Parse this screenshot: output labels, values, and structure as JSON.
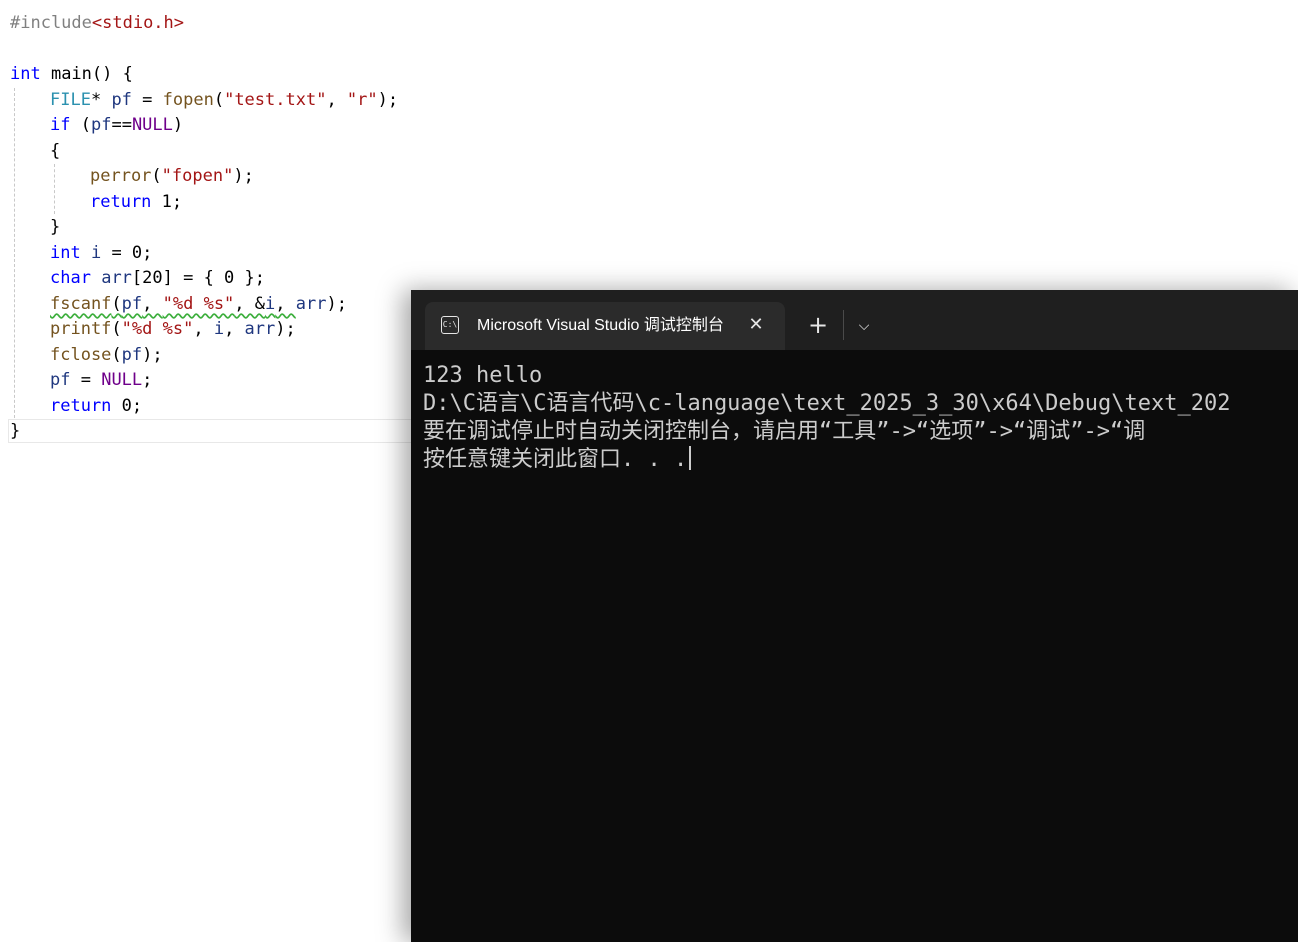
{
  "editor": {
    "l1": {
      "a": "#include",
      "b": "<stdio.h>"
    },
    "l3": {
      "a": "int",
      "b": " main() {"
    },
    "l4": {
      "a": "FILE",
      "b": "* ",
      "c": "pf",
      "d": " = ",
      "e": "fopen",
      "f": "(",
      "g": "\"test.txt\"",
      "h": ", ",
      "i": "\"r\"",
      "j": ");"
    },
    "l5": {
      "a": "if",
      "b": " (",
      "c": "pf",
      "d": "==",
      "e": "NULL",
      "f": ")"
    },
    "l6": {
      "a": "{"
    },
    "l7": {
      "a": "perror",
      "b": "(",
      "c": "\"fopen\"",
      "d": ");"
    },
    "l8": {
      "a": "return",
      "b": " 1;"
    },
    "l9": {
      "a": "}"
    },
    "l10": {
      "a": "int",
      "b": " ",
      "c": "i",
      "d": " = 0;"
    },
    "l11": {
      "a": "char",
      "b": " ",
      "c": "arr",
      "d": "[20] = { 0 };"
    },
    "l12": {
      "a": "fscanf",
      "b": "(",
      "c": "pf",
      "d": ", ",
      "e": "\"%d %s\"",
      "f": ", &",
      "g": "i",
      "h": ", ",
      "i": "arr",
      "j": ");"
    },
    "l13": {
      "a": "printf",
      "b": "(",
      "c": "\"%d %s\"",
      "d": ", ",
      "e": "i",
      "f": ", ",
      "g": "arr",
      "h": ");"
    },
    "l14": {
      "a": "fclose",
      "b": "(",
      "c": "pf",
      "d": ");"
    },
    "l15": {
      "a": "pf",
      "b": " = ",
      "c": "NULL",
      "d": ";"
    },
    "l16": {
      "a": "return",
      "b": " 0;"
    },
    "l17": {
      "a": "}"
    }
  },
  "terminal": {
    "tab_title": "Microsoft Visual Studio 调试控制台",
    "tab_icon": "terminal-icon",
    "close_glyph": "✕",
    "new_tab_glyph": "+",
    "dropdown_glyph": "⌵",
    "icon_text": "C:\\",
    "lines": [
      "123 hello",
      "D:\\C语言\\C语言代码\\c-language\\text_2025_3_30\\x64\\Debug\\text_202",
      "要在调试停止时自动关闭控制台，请启用“工具”->“选项”->“调试”->“调",
      "按任意键关闭此窗口. . ."
    ]
  }
}
